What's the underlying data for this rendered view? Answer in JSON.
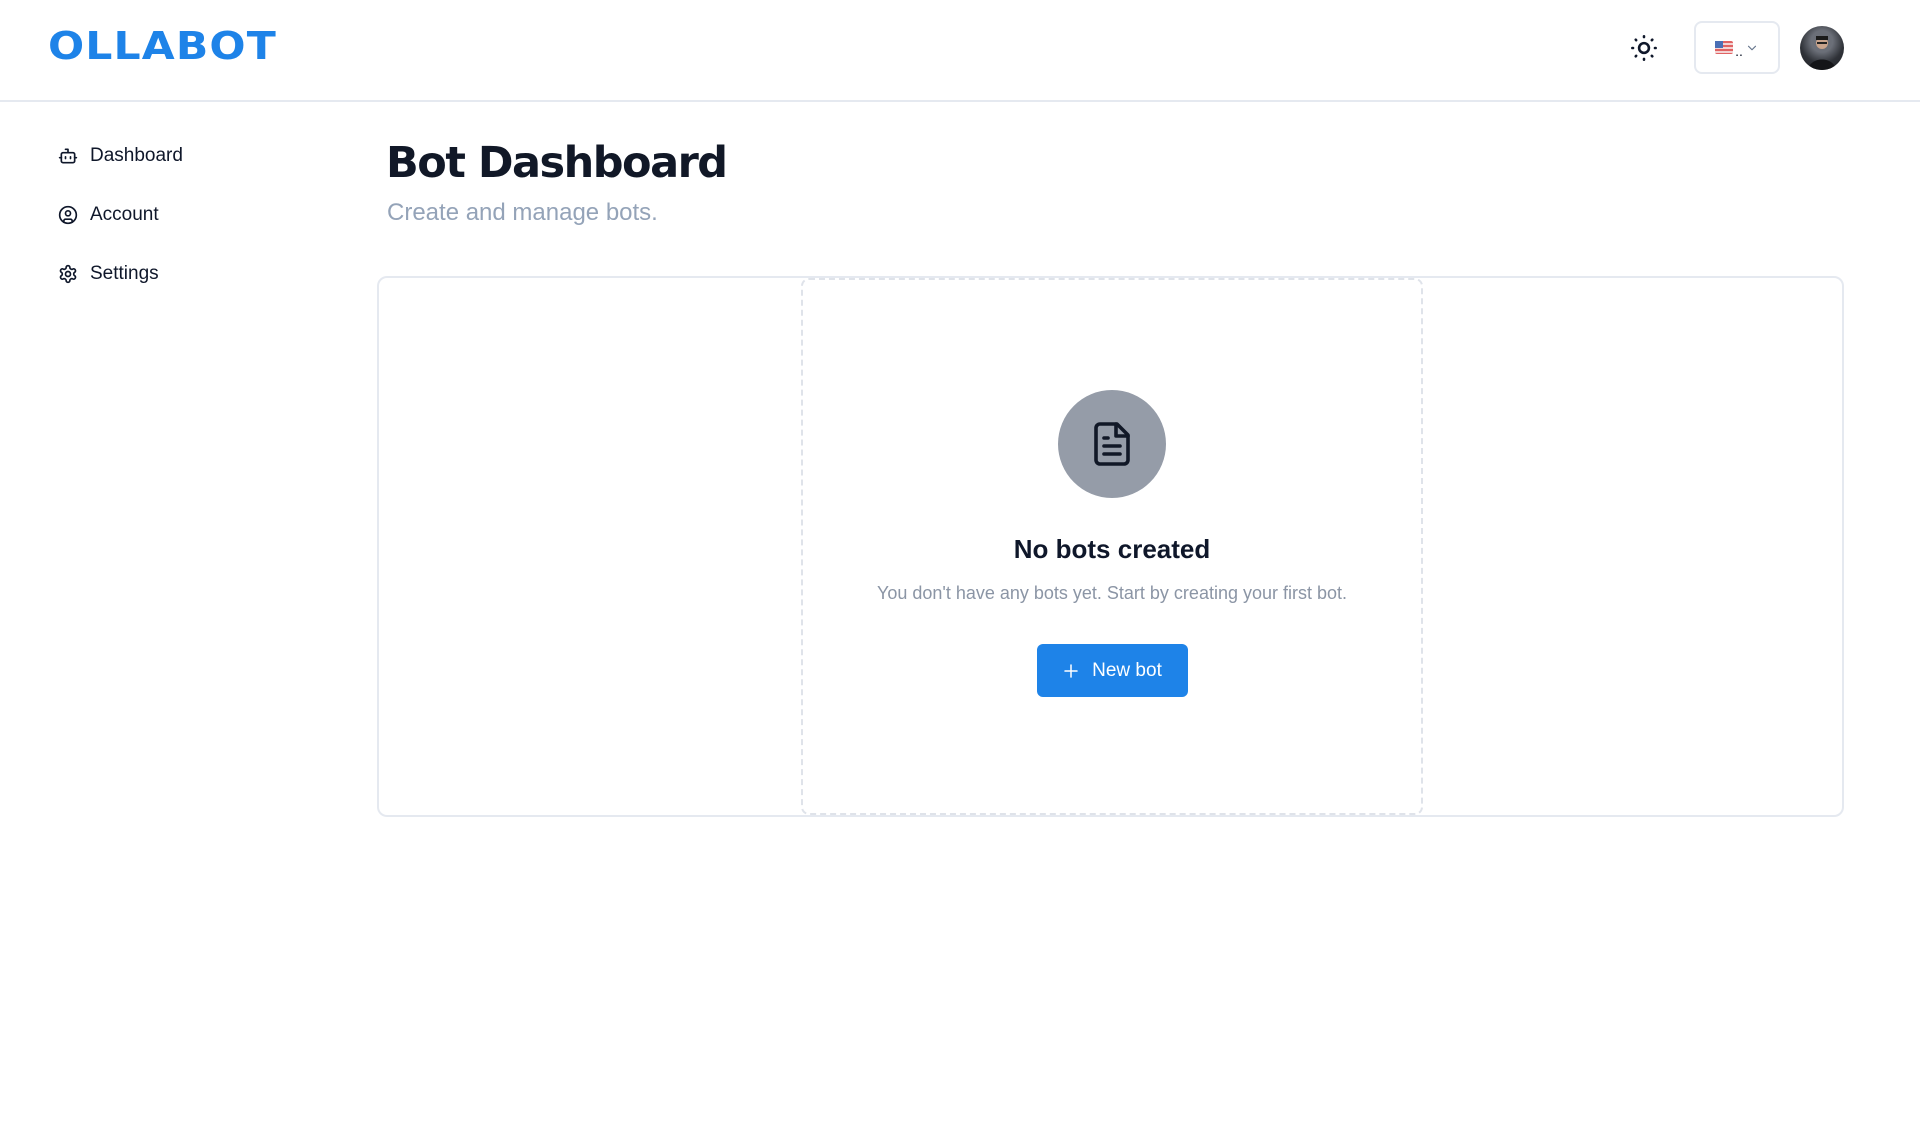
{
  "header": {
    "logo": "OLLABOT",
    "theme_toggle_icon": "sun-icon",
    "language": {
      "flag": "us-flag-icon",
      "label": "..",
      "chevron": "chevron-down-icon"
    },
    "avatar_icon": "user-avatar"
  },
  "sidebar": {
    "items": [
      {
        "label": "Dashboard",
        "icon": "bot-icon"
      },
      {
        "label": "Account",
        "icon": "user-circle-icon"
      },
      {
        "label": "Settings",
        "icon": "gear-icon"
      }
    ]
  },
  "main": {
    "title": "Bot Dashboard",
    "subtitle": "Create and manage bots.",
    "empty_state": {
      "icon": "document-icon",
      "title": "No bots created",
      "description": "You don't have any bots yet. Start by creating your first bot.",
      "button_label": "New bot",
      "button_icon": "plus-icon"
    }
  },
  "colors": {
    "brand": "#1e83e8",
    "text": "#0f172a",
    "muted": "#94a3b8",
    "border": "#e5e9f0"
  }
}
